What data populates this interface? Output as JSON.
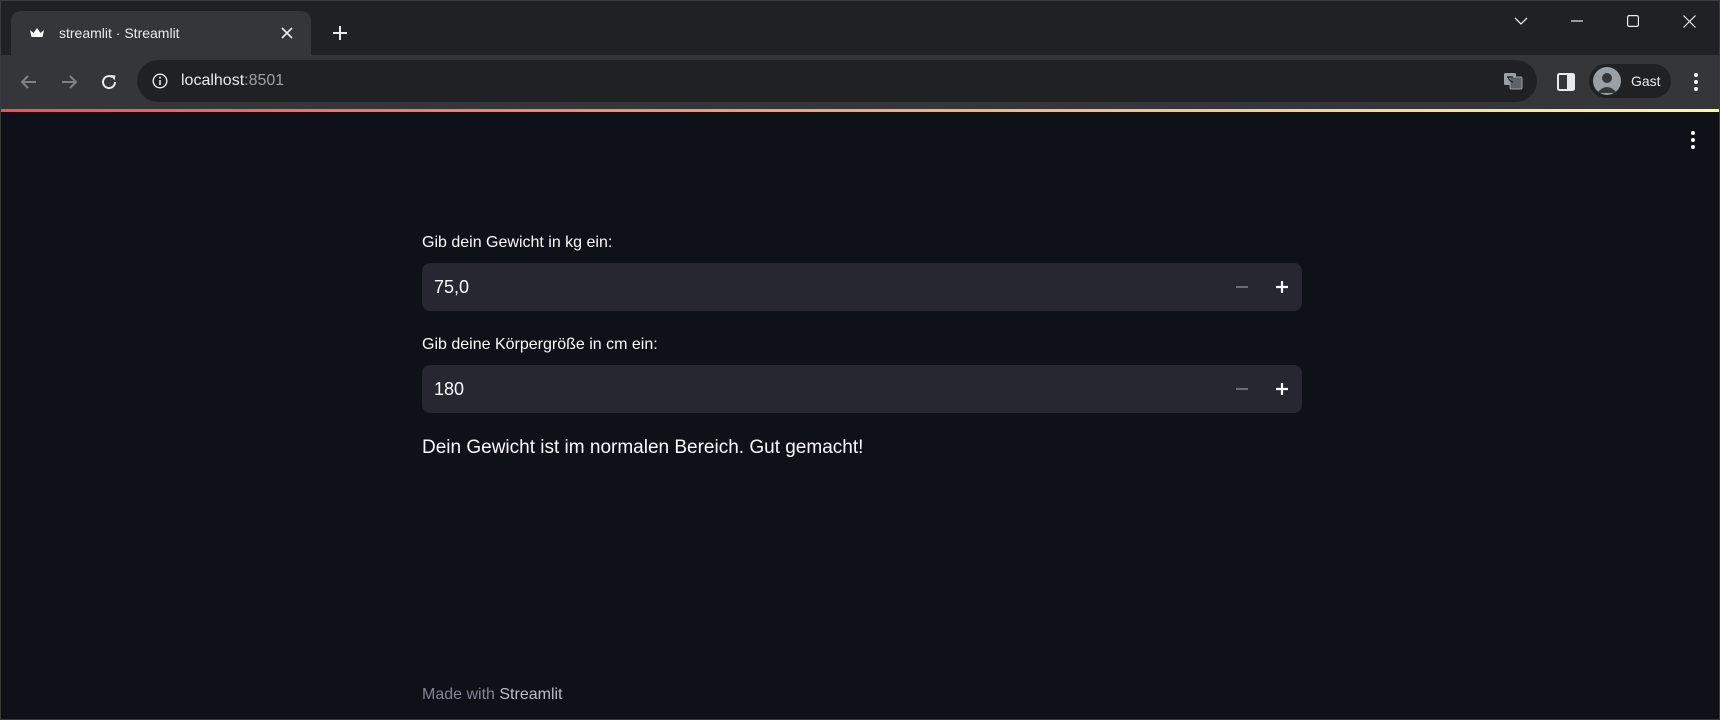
{
  "browser": {
    "tab_title": "streamlit · Streamlit",
    "url_host": "localhost",
    "url_port": ":8501",
    "profile_label": "Gast"
  },
  "app": {
    "weight": {
      "label": "Gib dein Gewicht in kg ein:",
      "value": "75,0"
    },
    "height": {
      "label": "Gib deine Körpergröße in cm ein:",
      "value": "180"
    },
    "result_message": "Dein Gewicht ist im normalen Bereich. Gut gemacht!",
    "footer_prefix": "Made with",
    "footer_brand": "Streamlit"
  },
  "colors": {
    "background": "#0e1117",
    "input_background": "#262730",
    "text": "#fafafa",
    "accent_start": "#ff4b4b",
    "accent_end": "#fffd80"
  },
  "icons": [
    "streamlit-crown-icon",
    "close-icon",
    "plus-icon",
    "chevron-down-icon",
    "minimize-icon",
    "maximize-icon",
    "close-window-icon",
    "back-arrow-icon",
    "forward-arrow-icon",
    "reload-icon",
    "info-icon",
    "translate-icon",
    "side-panel-icon",
    "person-icon",
    "vertical-dots-icon",
    "minus-icon"
  ]
}
